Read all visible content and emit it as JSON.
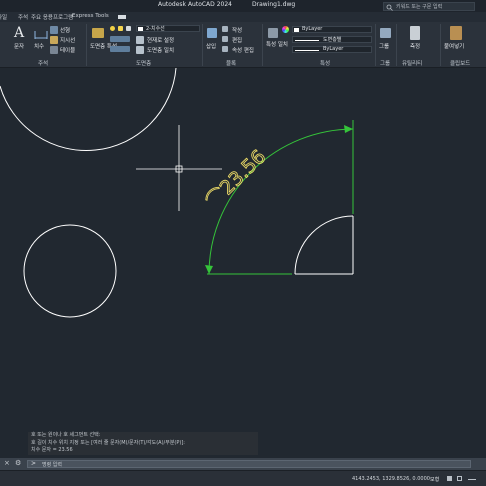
{
  "window": {
    "title_app": "Autodesk AutoCAD 2024",
    "title_file": "Drawing1.dwg",
    "search_placeholder": "키워드 또는 구문 입력"
  },
  "menu_tabs": [
    "파일",
    "주석",
    "주요 응용프로그램",
    "Express Tools"
  ],
  "ribbon": {
    "annotation": {
      "text_label": "문자",
      "dimension_label": "치수",
      "linear_label": "선형",
      "leader_label": "지시선",
      "table_label": "테이블",
      "panel_label": "주석"
    },
    "layers": {
      "layer_props_label": "도면층 특성",
      "current_layer": "2-치수선",
      "make_current_label": "현재로 설정",
      "match_layer_label": "도면층 일치",
      "panel_label": "도면층"
    },
    "block": {
      "insert_label": "삽입",
      "create_label": "작성",
      "edit_label": "편집",
      "attr_label": "속성 편집",
      "panel_label": "블록"
    },
    "properties": {
      "match_label": "특성 일치",
      "color": "ByLayer",
      "linetype": "도면층별",
      "lineweight": "ByLayer",
      "panel_label": "특성"
    },
    "groups": {
      "group_label": "그룹",
      "panel_label": "그룹"
    },
    "utilities": {
      "measure_label": "측정",
      "panel_label": "유틸리티"
    },
    "clipboard": {
      "paste_label": "붙여넣기",
      "panel_label": "클립보드"
    }
  },
  "drawing": {
    "dimension_text": "⌒23.56"
  },
  "command_history": [
    "호 또는 원이나 호 세그먼트 선택:",
    "호 길이 치수 위치 지정 또는 [여러 줄 문자(M)/문자(T)/각도(A)/부분(P)]:",
    "치수 문자 = 23.56"
  ],
  "command_input_placeholder": "명령 입력",
  "status": {
    "coordinates": "4143.2453, 1329.8526, 0.0000",
    "model_label": "모형"
  },
  "colors": {
    "canvas_bg": "#212830",
    "dimension_green": "#35c43a",
    "dimension_text_yellow": "#e9d866",
    "geometry_white": "#ffffff"
  }
}
